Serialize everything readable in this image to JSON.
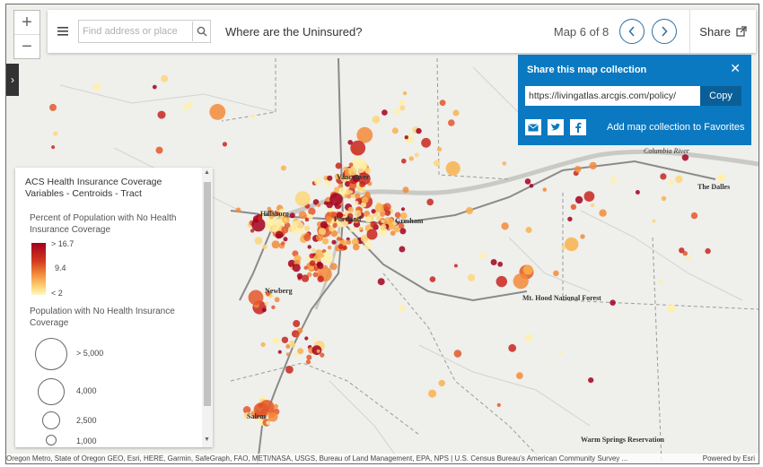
{
  "header": {
    "search_placeholder": "Find address or place",
    "title": "Where are the Uninsured?",
    "map_counter": "Map 6 of 8",
    "share_label": "Share"
  },
  "zoom": {
    "in_label": "+",
    "out_label": "−"
  },
  "share_panel": {
    "title": "Share this map collection",
    "url": "https://livingatlas.arcgis.com/policy/",
    "copy_label": "Copy",
    "favorites_label": "Add map collection to Favorites"
  },
  "legend": {
    "title": "ACS Health Insurance Coverage Variables - Centroids - Tract",
    "color_field": "Percent of Population with No Health Insurance Coverage",
    "color_stops": [
      "> 16.7",
      "9.4",
      "< 2"
    ],
    "size_field": "Population with No Health Insurance Coverage",
    "size_stops": [
      "> 5,000",
      "4,000",
      "2,500",
      "1,000"
    ]
  },
  "map_labels": {
    "cities": [
      "Vancouver",
      "Portland",
      "Gresham",
      "Hillsboro",
      "Newberg",
      "Salem",
      "The Dalles"
    ],
    "features": [
      "Mt. Hood National Forest",
      "Warm Springs Reservation",
      "Columbia River"
    ]
  },
  "attribution": {
    "text": "Oregon Metro, State of Oregon GEO, Esri, HERE, Garmin, SafeGraph, FAO, METI/NASA, USGS, Bureau of Land Management, EPA, NPS | U.S. Census Bureau's American Community Survey ...",
    "powered": "Powered by Esri"
  },
  "colors": {
    "accent": "#0a79c1",
    "dark": "#a3001f",
    "mid": "#f28b3a",
    "light": "#fdd67a"
  }
}
